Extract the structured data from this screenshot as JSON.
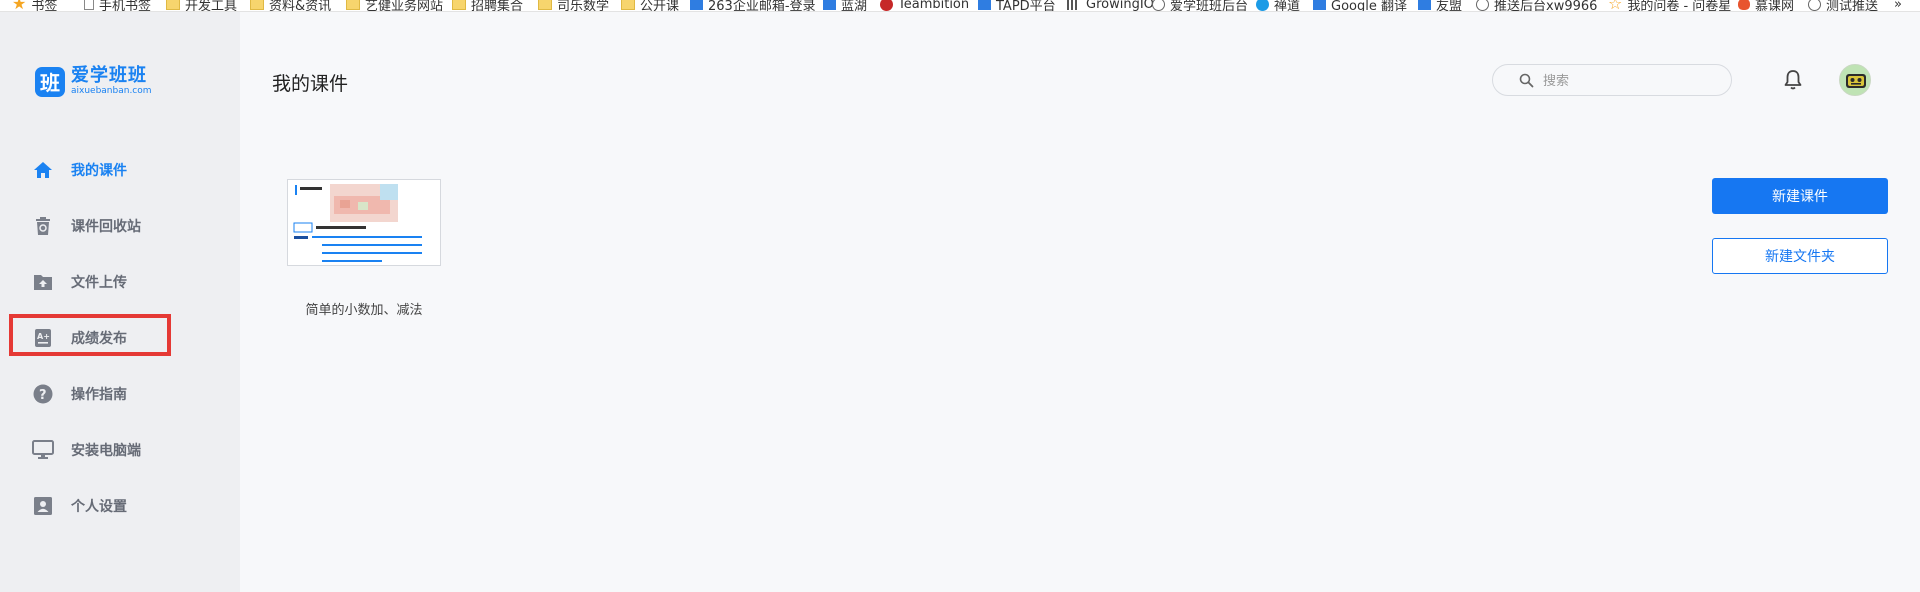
{
  "bookmarks": [
    {
      "label": "书签",
      "icon": "star-icon"
    },
    {
      "label": "手机书签",
      "icon": "phone-icon"
    },
    {
      "label": "开发工具",
      "icon": "folder-icon"
    },
    {
      "label": "资料&资讯",
      "icon": "folder-icon"
    },
    {
      "label": "艺健业务网站",
      "icon": "folder-icon"
    },
    {
      "label": "招聘集合",
      "icon": "folder-icon"
    },
    {
      "label": "司乐数学",
      "icon": "folder-icon"
    },
    {
      "label": "公开课",
      "icon": "folder-icon"
    },
    {
      "label": "263企业邮箱-登录",
      "icon": "mail-icon"
    },
    {
      "label": "蓝湖",
      "icon": "lanhu-icon"
    },
    {
      "label": "Teambition",
      "icon": "teambition-icon"
    },
    {
      "label": "TAPD平台",
      "icon": "tapd-icon"
    },
    {
      "label": "GrowingIO",
      "icon": "growingio-icon"
    },
    {
      "label": "爱学班班后台",
      "icon": "globe-icon"
    },
    {
      "label": "禅道",
      "icon": "zentao-icon"
    },
    {
      "label": "Google 翻译",
      "icon": "translate-icon"
    },
    {
      "label": "友盟",
      "icon": "umeng-icon"
    },
    {
      "label": "推送后台xw9966",
      "icon": "globe-icon"
    },
    {
      "label": "我的问卷 - 问卷星",
      "icon": "wjx-icon"
    },
    {
      "label": "慕课网",
      "icon": "imooc-icon"
    },
    {
      "label": "测试推送",
      "icon": "globe-icon"
    }
  ],
  "logo": {
    "badge": "班",
    "name": "爱学班班",
    "domain": "aixuebanban.com"
  },
  "nav": [
    {
      "label": "我的课件",
      "icon": "home-icon",
      "active": true
    },
    {
      "label": "课件回收站",
      "icon": "trash-icon",
      "active": false
    },
    {
      "label": "文件上传",
      "icon": "upload-folder-icon",
      "active": false
    },
    {
      "label": "成绩发布",
      "icon": "grade-icon",
      "active": false
    },
    {
      "label": "操作指南",
      "icon": "help-icon",
      "active": false
    },
    {
      "label": "安装电脑端",
      "icon": "monitor-icon",
      "active": false
    },
    {
      "label": "个人设置",
      "icon": "user-card-icon",
      "active": false
    }
  ],
  "header": {
    "title": "我的课件",
    "search_placeholder": "搜索"
  },
  "courseware": [
    {
      "title": "简单的小数加、减法"
    }
  ],
  "actions": {
    "new_course": "新建课件",
    "new_folder": "新建文件夹"
  },
  "colors": {
    "accent": "#1677f2",
    "highlight": "#e53935"
  }
}
